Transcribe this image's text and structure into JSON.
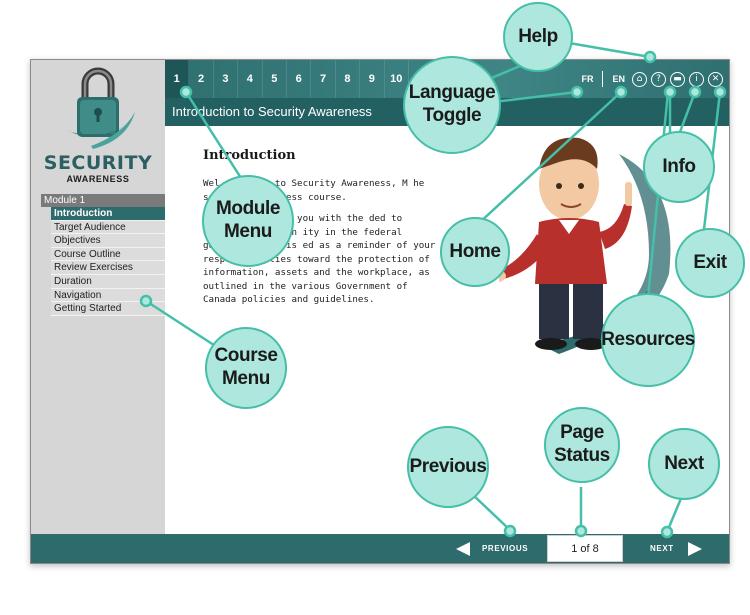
{
  "logo": {
    "title": "SECURITY",
    "subtitle": "AWARENESS"
  },
  "sidebar": {
    "module_label": "Module 1",
    "items": [
      {
        "label": "Introduction",
        "active": true
      },
      {
        "label": "Target Audience"
      },
      {
        "label": "Objectives"
      },
      {
        "label": "Course Outline"
      },
      {
        "label": "Review Exercises"
      },
      {
        "label": "Duration"
      },
      {
        "label": "Navigation"
      },
      {
        "label": "Getting Started"
      }
    ]
  },
  "topbar": {
    "pages": [
      "1",
      "2",
      "3",
      "4",
      "5",
      "6",
      "7",
      "8",
      "9",
      "10",
      "1"
    ],
    "current_page": "1",
    "lang_fr": "FR",
    "lang_en": "EN",
    "icons": [
      "home-icon",
      "help-icon",
      "resources-icon",
      "info-icon",
      "exit-icon"
    ]
  },
  "page_title": "Introduction to Security Awareness",
  "content": {
    "heading": "Introduction",
    "paragraph1": "Wel            oduction to Security Awareness, M            he security awareness course.",
    "paragraph2": "                se is to provide you with the              ded to understand the in            ity in the federal government. It is            ed as a reminder of your responsibilities toward the protection of information, assets and the workplace, as outlined in the various Government of Canada policies and guidelines."
  },
  "footer": {
    "previous_label": "PREVIOUS",
    "next_label": "NEXT",
    "page_status": "1 of 8"
  },
  "callouts": {
    "help": "Help",
    "language_toggle": "Language Toggle",
    "info": "Info",
    "module_menu": "Module Menu",
    "home": "Home",
    "exit": "Exit",
    "resources": "Resources",
    "course_menu": "Course Menu",
    "previous": "Previous",
    "page_status": "Page Status",
    "next": "Next"
  },
  "colors": {
    "accent": "#2e6b6d",
    "callout_fill": "#aee7dd",
    "callout_border": "#45bfa8"
  }
}
